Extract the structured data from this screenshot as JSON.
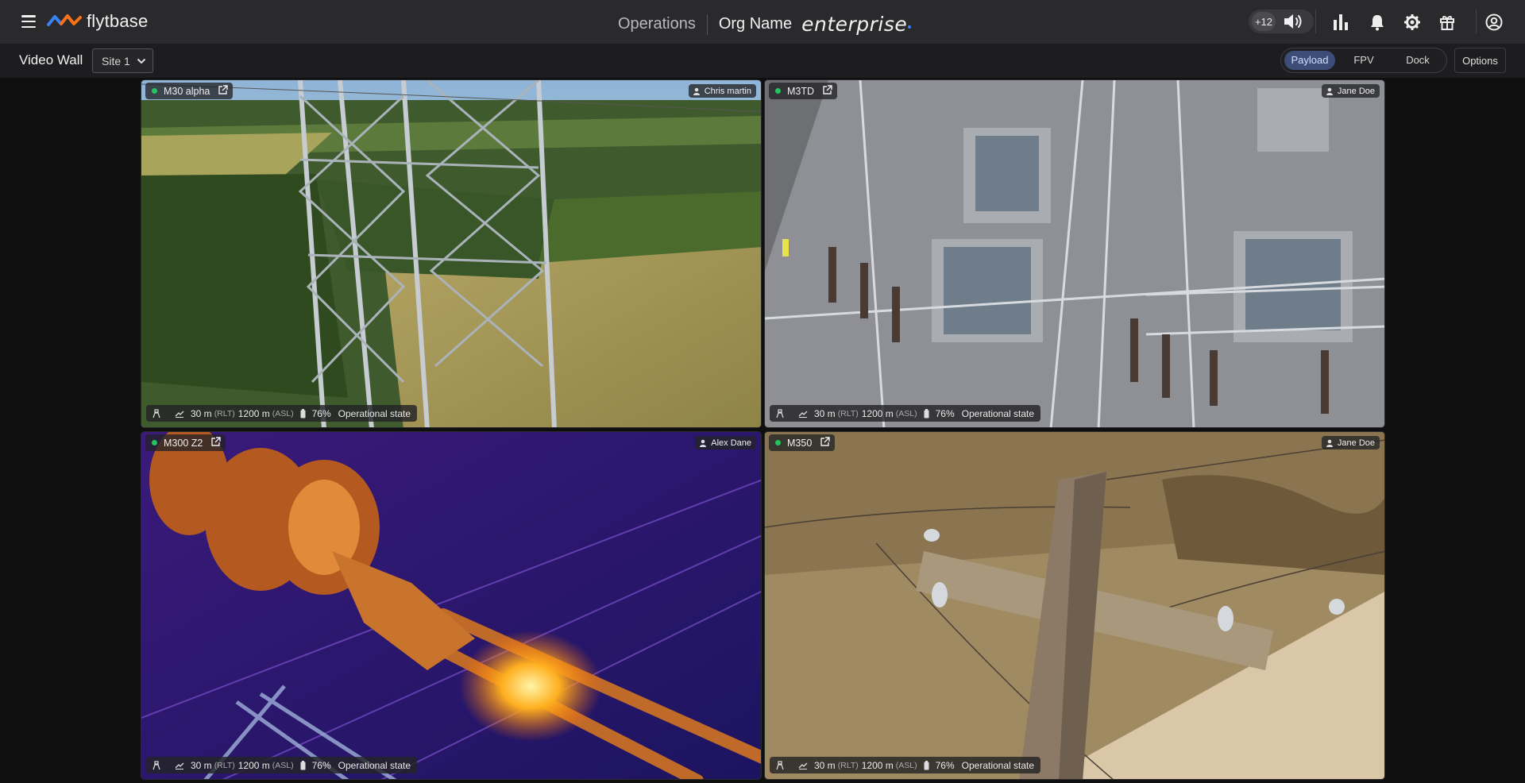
{
  "header": {
    "brand": "flytbase",
    "section": "Operations",
    "org_name": "Org Name",
    "plan": "enterprise",
    "plus_count": "+12"
  },
  "icons": {
    "menu": "hamburger-icon",
    "speaker": "speaker-icon",
    "analytics": "bar-chart-icon",
    "notifications": "bell-icon",
    "settings": "gear-icon",
    "gift": "gift-icon",
    "account": "user-circle-icon"
  },
  "subbar": {
    "title": "Video Wall",
    "site_selected": "Site 1",
    "view_tabs": [
      "Payload",
      "FPV",
      "Dock"
    ],
    "active_tab": "Payload",
    "options_label": "Options"
  },
  "tiles": [
    {
      "drone": "M30 alpha",
      "pilot": "Chris martin",
      "alt_rlt": "30 m",
      "rlt_unit": "(RLT)",
      "alt_asl": "1200 m",
      "asl_unit": "(ASL)",
      "battery": "76%",
      "state": "Operational state",
      "status_color": "#22c55e"
    },
    {
      "drone": "M3TD",
      "pilot": "Jane Doe",
      "alt_rlt": "30 m",
      "rlt_unit": "(RLT)",
      "alt_asl": "1200 m",
      "asl_unit": "(ASL)",
      "battery": "76%",
      "state": "Operational state",
      "status_color": "#22c55e"
    },
    {
      "drone": "M300 Z2",
      "pilot": "Alex Dane",
      "alt_rlt": "30 m",
      "rlt_unit": "(RLT)",
      "alt_asl": "1200 m",
      "asl_unit": "(ASL)",
      "battery": "76%",
      "state": "Operational state",
      "status_color": "#22c55e"
    },
    {
      "drone": "M350",
      "pilot": "Jane Doe",
      "alt_rlt": "30 m",
      "rlt_unit": "(RLT)",
      "alt_asl": "1200 m",
      "asl_unit": "(ASL)",
      "battery": "76%",
      "state": "Operational state",
      "status_color": "#22c55e"
    }
  ]
}
